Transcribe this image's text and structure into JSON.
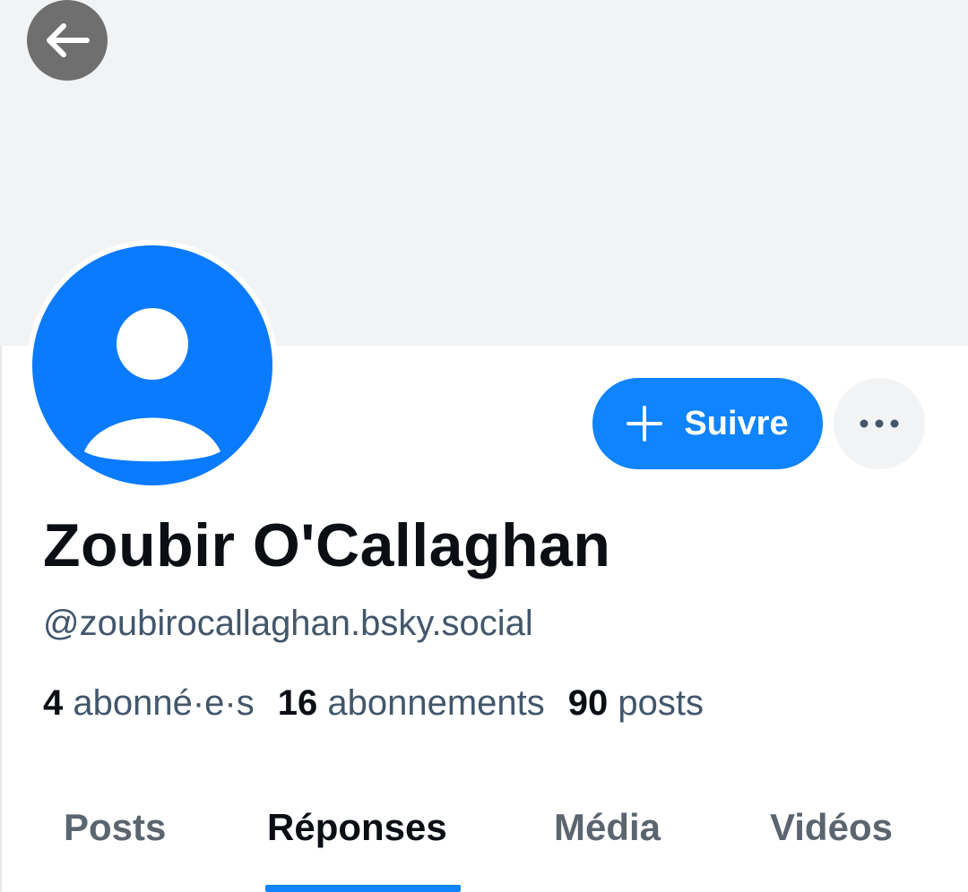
{
  "profile": {
    "display_name": "Zoubir O'Callaghan",
    "handle": "@zoubirocallaghan.bsky.social"
  },
  "actions": {
    "follow_label": "Suivre"
  },
  "stats": [
    {
      "value": "4",
      "label": "abonné·e·s"
    },
    {
      "value": "16",
      "label": "abonnements"
    },
    {
      "value": "90",
      "label": "posts"
    }
  ],
  "tabs": [
    {
      "label": "Posts",
      "active": false
    },
    {
      "label": "Réponses",
      "active": true
    },
    {
      "label": "Média",
      "active": false
    },
    {
      "label": "Vidéos",
      "active": false
    }
  ],
  "colors": {
    "accent": "#1083fe",
    "avatar": "#0a7aff",
    "banner": "#f1f3f5",
    "text_primary": "#0b0f14",
    "text_secondary": "#42576c"
  },
  "icons": {
    "back": "arrow-left-icon",
    "follow": "plus-icon",
    "more": "ellipsis-icon",
    "avatar": "default-user-icon"
  }
}
